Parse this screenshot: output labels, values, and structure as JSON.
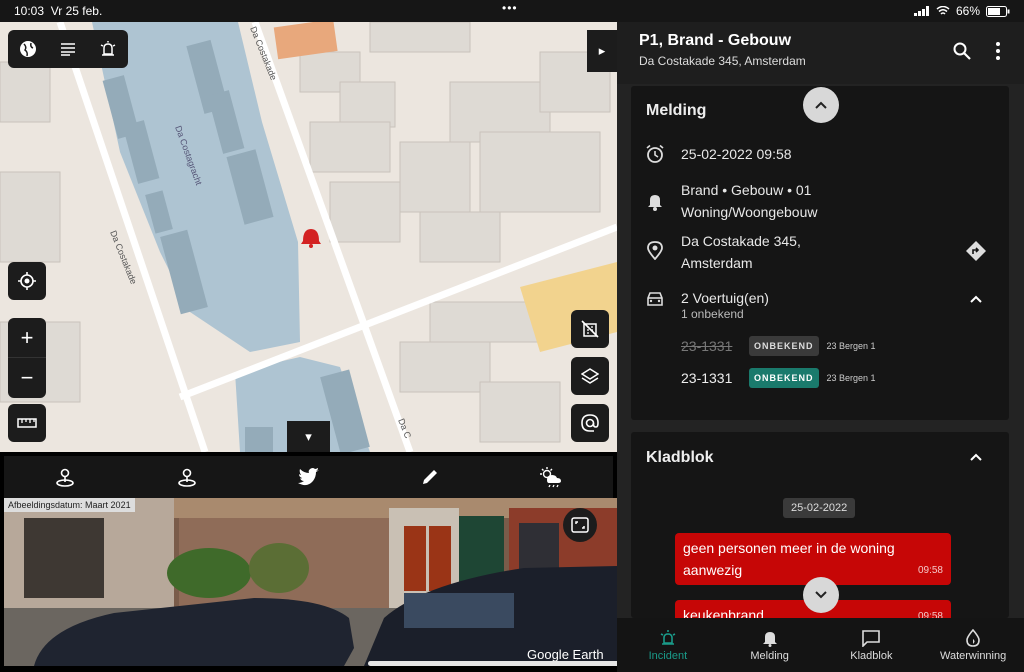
{
  "status": {
    "time": "10:03",
    "date": "Vr 25 feb.",
    "battery": "66%",
    "dots": "•••"
  },
  "map": {
    "street1": "Da Costakade",
    "street2": "Da Costakade",
    "canal": "Da Costagracht",
    "street3": "Da C",
    "toggle_glyph": "▸",
    "collapse_glyph": "▾",
    "zoom_in": "+",
    "zoom_out": "−"
  },
  "media": {
    "date_label": "Afbeeldingsdatum: Maart 2021",
    "credit": "Google Earth"
  },
  "header": {
    "title": "P1, Brand - Gebouw",
    "subtitle": "Da Costakade 345, Amsterdam"
  },
  "melding": {
    "title": "Melding",
    "datetime": "25-02-2022 09:58",
    "type_line1": "Brand • Gebouw • 01",
    "type_line2": "Woning/Woongebouw",
    "address_line1": "Da Costakade 345,",
    "address_line2": "Amsterdam",
    "vehicles_title": "2 Voertuig(en)",
    "vehicles_sub": "1 onbekend",
    "vehicles": [
      {
        "id": "23-1331",
        "status": "ONBEKEND",
        "location": "23 Bergen 1",
        "struck": true
      },
      {
        "id": "23-1331",
        "status": "ONBEKEND",
        "location": "23 Bergen 1",
        "struck": false
      }
    ]
  },
  "kladblok": {
    "title": "Kladblok",
    "date_chip": "25-02-2022",
    "messages": [
      {
        "text": "geen personen meer in de woning aanwezig",
        "time": "09:58"
      },
      {
        "text": "keukenbrand",
        "time": "09:58"
      }
    ]
  },
  "nav": [
    {
      "label": "Incident",
      "active": true
    },
    {
      "label": "Melding"
    },
    {
      "label": "Kladblok"
    },
    {
      "label": "Waterwinning"
    }
  ],
  "colors": {
    "accent": "#1a9b8a",
    "alert": "#c60606",
    "panel": "#232323",
    "card": "#151515",
    "map_water": "#aec4d2",
    "map_land": "#ece6df"
  },
  "icons": [
    "globe-icon",
    "list-icon",
    "alarm-bell-icon",
    "locate-icon",
    "ruler-icon",
    "building-off-icon",
    "layers-icon",
    "at-icon",
    "person-pin-icon",
    "twitter-icon",
    "pencil-icon",
    "weather-icon",
    "expand-icon",
    "search-icon",
    "more-icon",
    "clock-icon",
    "bell-icon",
    "pin-icon",
    "directions-icon",
    "car-icon"
  ]
}
